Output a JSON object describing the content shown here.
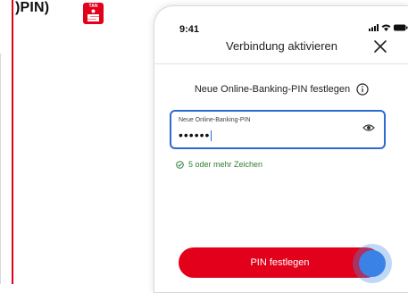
{
  "page": {
    "title_fragment": ")PIN)"
  },
  "app_icon": {
    "label": "TAN",
    "brand_color": "#e2001a"
  },
  "phone": {
    "status_bar": {
      "time": "9:41"
    },
    "nav": {
      "title": "Verbindung aktivieren",
      "close_icon": "close-icon"
    },
    "heading": "Neue Online-Banking-PIN festlegen",
    "pin_field": {
      "label": "Neue Online-Banking-PIN",
      "value": "••••••"
    },
    "hint": "5 oder mehr Zeichen",
    "submit": {
      "label": "PIN festlegen"
    }
  },
  "colors": {
    "accent_red": "#e2001a",
    "focus_blue": "#2e6ad1",
    "success_green": "#2e7d32"
  }
}
